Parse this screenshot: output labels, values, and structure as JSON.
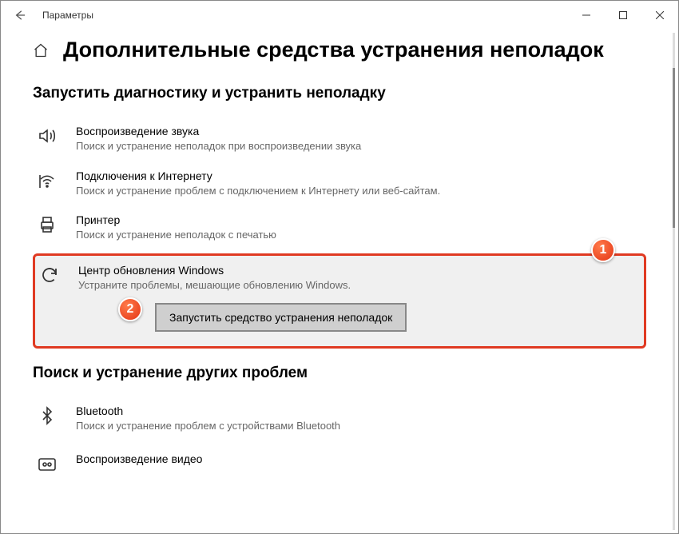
{
  "window": {
    "title": "Параметры"
  },
  "page": {
    "heading": "Дополнительные средства устранения неполадок"
  },
  "section1": {
    "title": "Запустить диагностику и устранить неполадку",
    "items": [
      {
        "title": "Воспроизведение звука",
        "desc": "Поиск и устранение неполадок при воспроизведении звука"
      },
      {
        "title": "Подключения к Интернету",
        "desc": "Поиск и устранение проблем с подключением к Интернету или веб-сайтам."
      },
      {
        "title": "Принтер",
        "desc": "Поиск и устранение неполадок с печатью"
      },
      {
        "title": "Центр обновления Windows",
        "desc": "Устраните проблемы, мешающие обновлению Windows."
      }
    ],
    "run_label": "Запустить средство устранения неполадок"
  },
  "section2": {
    "title": "Поиск и устранение других проблем",
    "items": [
      {
        "title": "Bluetooth",
        "desc": "Поиск и устранение проблем с устройствами Bluetooth"
      },
      {
        "title": "Воспроизведение видео",
        "desc": ""
      }
    ]
  },
  "annotations": {
    "a1": "1",
    "a2": "2"
  }
}
